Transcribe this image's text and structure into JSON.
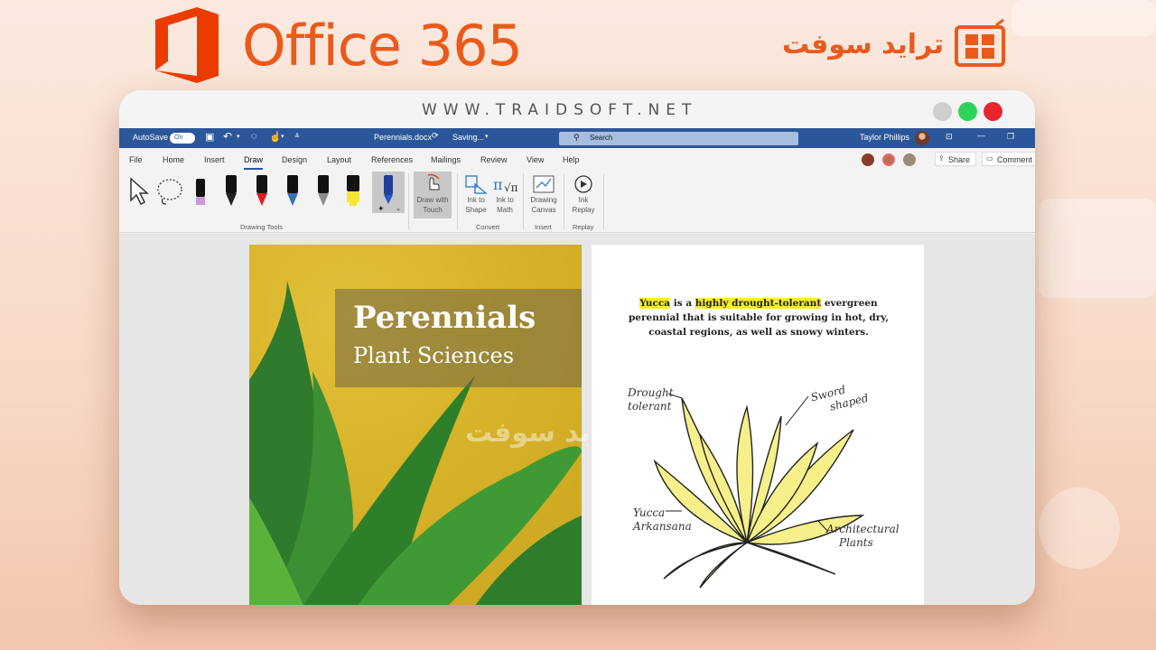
{
  "brand": {
    "office_title": "Office 365",
    "traidsoft_name": "ترايد سوفت",
    "url": "WWW.TRAIDSOFT.NET"
  },
  "colors": {
    "accent_orange": "#eb5a1a",
    "word_blue": "#2b579a",
    "dot_gray": "#cfcfcf",
    "dot_green": "#2ed35a",
    "dot_red": "#e8262e"
  },
  "titlebar": {
    "autosave_label": "AutoSave",
    "autosave_state": "On",
    "filename": "Perennials.docx",
    "save_status": "Saving...",
    "search_placeholder": "Search",
    "user_name": "Taylor Phillips"
  },
  "menu": {
    "tabs": [
      "File",
      "Home",
      "Insert",
      "Draw",
      "Design",
      "Layout",
      "References",
      "Mailings",
      "Review",
      "View",
      "Help"
    ],
    "active": "Draw",
    "share_label": "Share",
    "comment_label": "Comment"
  },
  "ribbon": {
    "draw_touch": "Draw with Touch",
    "draw_touch_l1": "Draw with",
    "draw_touch_l2": "Touch",
    "ink_shape_l1": "Ink to",
    "ink_shape_l2": "Shape",
    "ink_math_l1": "Ink to",
    "ink_math_l2": "Math",
    "canvas_l1": "Drawing",
    "canvas_l2": "Canvas",
    "replay_l1": "Ink",
    "replay_l2": "Replay",
    "groups": {
      "drawing_tools": "Drawing Tools",
      "convert": "Convert",
      "insert": "Insert",
      "replay": "Replay"
    }
  },
  "document": {
    "title": "Perennials",
    "subtitle": "Plant Sciences",
    "intro": {
      "p1": "Yucca",
      "p2": " is a ",
      "p3": "highly drought-tolerant",
      "p4": " evergreen perennial that is suitable for growing in hot, dry, coastal regions, as well as snowy winters."
    },
    "annotations": {
      "drought_1": "Drought",
      "drought_2": "tolerant",
      "sword_1": "Sword",
      "sword_2": "shaped",
      "yucca_1": "Yucca",
      "yucca_2": "Arkansana",
      "arch_1": "Architectural",
      "arch_2": "Plants"
    }
  },
  "watermark": "ترايد سوفت"
}
